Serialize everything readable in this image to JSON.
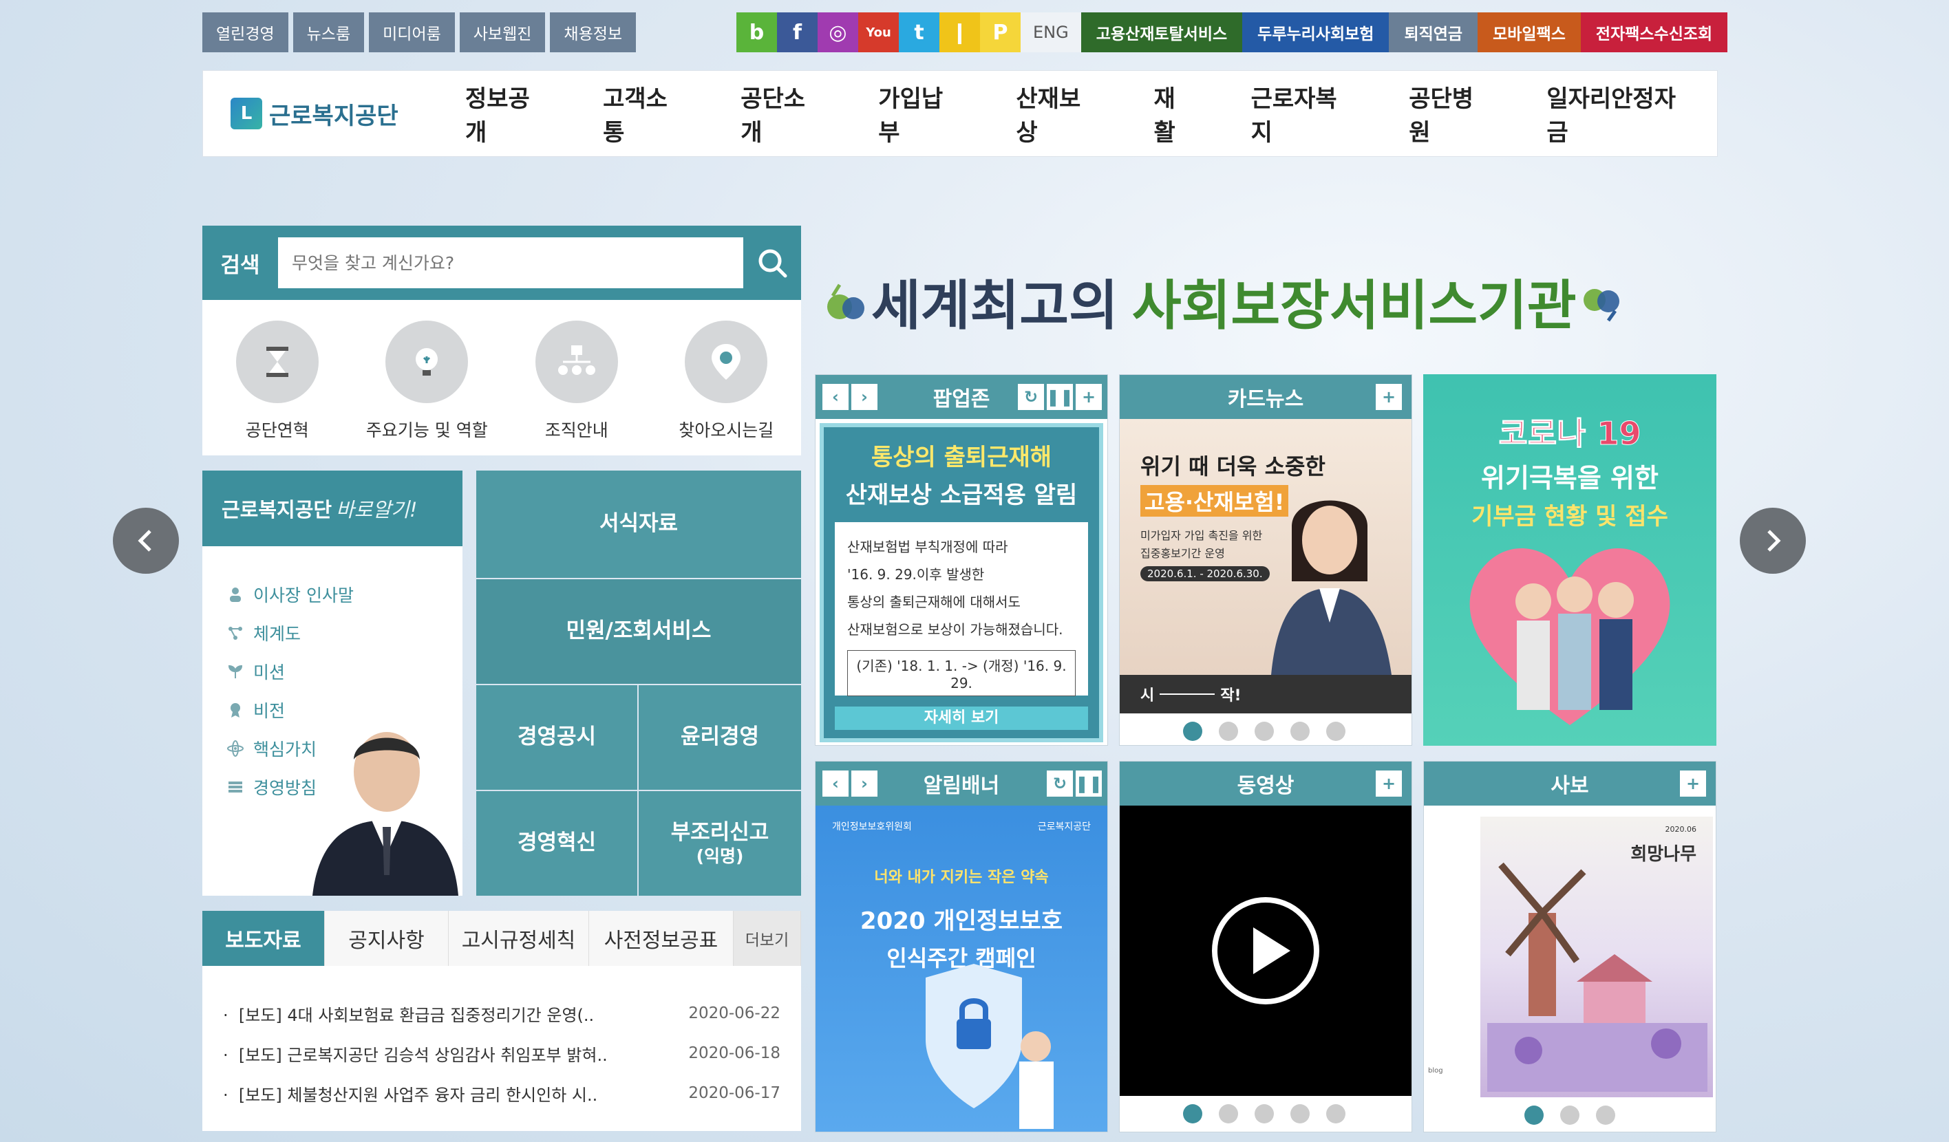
{
  "util_links": [
    "열린경영",
    "뉴스룸",
    "미디어룸",
    "사보웹진",
    "채용정보"
  ],
  "social": [
    {
      "name": "blog-icon",
      "glyph": "b",
      "color": "#5ab43a"
    },
    {
      "name": "facebook-icon",
      "glyph": "f",
      "color": "#3b5998"
    },
    {
      "name": "instagram-icon",
      "glyph": "◎",
      "color": "#a03bb0"
    },
    {
      "name": "youtube-icon",
      "glyph": "You",
      "color": "#d63a2b"
    },
    {
      "name": "twitter-icon",
      "glyph": "t",
      "color": "#2aa9e0"
    },
    {
      "name": "kakao-story-icon",
      "glyph": "❙",
      "color": "#f0c419"
    },
    {
      "name": "kakao-plus-icon",
      "glyph": "P",
      "color": "#f5d63a"
    }
  ],
  "eng": "ENG",
  "top_buttons": [
    {
      "label": "고용산재토탈서비스",
      "color": "#2f6b2a"
    },
    {
      "label": "두루누리사회보험",
      "color": "#245aa6"
    },
    {
      "label": "퇴직연금",
      "color": "#6a7f96"
    },
    {
      "label": "모바일팩스",
      "color": "#c85a1c"
    },
    {
      "label": "전자팩스수신조회",
      "color": "#c8203c"
    }
  ],
  "logo": {
    "mark": "L",
    "text": "근로복지공단"
  },
  "gnb": [
    "정보공개",
    "고객소통",
    "공단소개",
    "가입납부",
    "산재보상",
    "재활",
    "근로자복지",
    "공단병원",
    "일자리안정자금"
  ],
  "search": {
    "label": "검색",
    "placeholder": "무엇을 찾고 계신가요?"
  },
  "quick_links": [
    "공단연혁",
    "주요기능 및 역할",
    "조직안내",
    "찾아오시는길"
  ],
  "know": {
    "title": "근로복지공단",
    "title_script": "바로알기!",
    "items": [
      "이사장 인사말",
      "체계도",
      "미션",
      "비전",
      "핵심가치",
      "경영방침"
    ]
  },
  "tiles": {
    "forms": "서식자료",
    "civil": "민원/조회서비스",
    "mgmt_public": "경영공시",
    "ethics": "윤리경영",
    "innovation": "경영혁신",
    "report": "부조리신고",
    "report_sub": "(익명)"
  },
  "news_tabs": [
    "보도자료",
    "공지사항",
    "고시규정세칙",
    "사전정보공표"
  ],
  "news_more": "더보기",
  "news": [
    {
      "title": "[보도] 4대 사회보험료 환급금 집중정리기간 운영(..",
      "date": "2020-06-22"
    },
    {
      "title": "[보도] 근로복지공단 김승석 상임감사 취임포부 밝혀..",
      "date": "2020-06-18"
    },
    {
      "title": "[보도] 체불청산지원 사업주 융자 금리 한시인하 시..",
      "date": "2020-06-17"
    }
  ],
  "slogan": {
    "part1": "세계최고의",
    "part2": "사회보장서비스기관"
  },
  "panels": {
    "popup": {
      "title": "팝업존",
      "head1": "통상의 출퇴근재해",
      "head2": "산재보상 소급적용 알림",
      "lines": [
        "산재보험법 부칙개정에 따라",
        "'16. 9. 29.이후 발생한",
        "통상의 출퇴근재해에 대해서도",
        "산재보험으로 보상이 가능해졌습니다."
      ],
      "box": "(기존) '18. 1. 1. -> (개정) '16. 9. 29.",
      "btn": "자세히 보기"
    },
    "card": {
      "title": "카드뉴스",
      "h1": "위기 때 더욱 소중한",
      "h2": "고용·산재보험!",
      "sub1": "미가입자 가입 촉진을 위한",
      "sub2": "집중홍보기간 운영",
      "period": "2020.6.1. - 2020.6.30.",
      "foot1": "시",
      "foot2": "작!"
    },
    "corona": {
      "l1": "코로나 19",
      "l2": "위기극복을 위한",
      "l3": "기부금 현황 및 접수"
    },
    "banner": {
      "title": "알림배너",
      "org1": "개인정보보호위원회",
      "org2": "근로복지공단",
      "tag": "너와 내가 지키는 작은 약속",
      "h1": "2020 개인정보보호",
      "h2": "인식주간 캠페인"
    },
    "video": {
      "title": "동영상"
    },
    "sabo": {
      "title": "사보",
      "issue": "2020.06",
      "name": "희망나무",
      "blog": "blog"
    }
  },
  "colors": {
    "teal": "#3d8f9c",
    "teal_light": "#4f9aa4",
    "navy": "#2f3f5a",
    "green": "#3f8a2f"
  }
}
